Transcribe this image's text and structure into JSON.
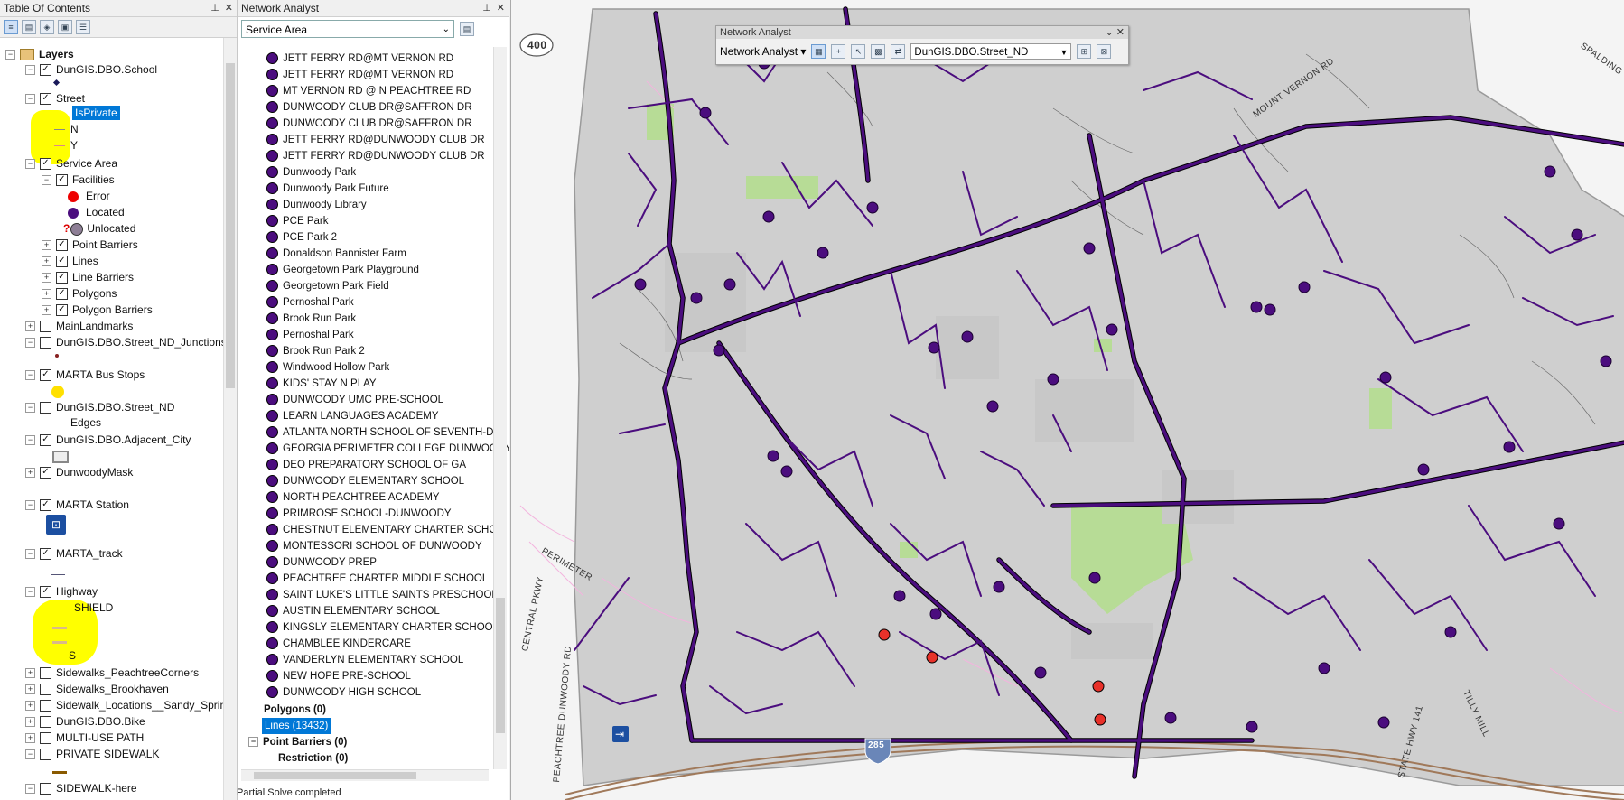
{
  "toc": {
    "title": "Table Of Contents",
    "layers_root": "Layers",
    "items": [
      {
        "label": "DunGIS.DBO.School",
        "checked": true
      },
      {
        "label": "Street",
        "checked": true
      },
      {
        "label": "IsPrivate"
      },
      {
        "label": "N"
      },
      {
        "label": "Y"
      },
      {
        "label": "Service Area",
        "checked": true
      },
      {
        "label": "Facilities",
        "checked": true
      },
      {
        "label": "Error"
      },
      {
        "label": "Located"
      },
      {
        "label": "Unlocated"
      },
      {
        "label": "Point Barriers",
        "checked": true
      },
      {
        "label": "Lines",
        "checked": true
      },
      {
        "label": "Line Barriers",
        "checked": true
      },
      {
        "label": "Polygons",
        "checked": true
      },
      {
        "label": "Polygon Barriers",
        "checked": true
      },
      {
        "label": "MainLandmarks",
        "checked": false
      },
      {
        "label": "DunGIS.DBO.Street_ND_Junctions",
        "checked": false
      },
      {
        "label": "MARTA Bus Stops",
        "checked": true
      },
      {
        "label": "DunGIS.DBO.Street_ND",
        "checked": false
      },
      {
        "label": "Edges"
      },
      {
        "label": "DunGIS.DBO.Adjacent_City",
        "checked": true
      },
      {
        "label": "DunwoodyMask",
        "checked": true
      },
      {
        "label": "MARTA Station",
        "checked": true
      },
      {
        "label": "MARTA_track",
        "checked": true
      },
      {
        "label": "Highway",
        "checked": true
      },
      {
        "label": "SHIELD"
      },
      {
        "label": "S"
      },
      {
        "label": "Sidewalks_PeachtreeCorners",
        "checked": false
      },
      {
        "label": "Sidewalks_Brookhaven",
        "checked": false
      },
      {
        "label": "Sidewalk_Locations__Sandy_Sprin",
        "checked": false
      },
      {
        "label": "DunGIS.DBO.Bike",
        "checked": false
      },
      {
        "label": "MULTI-USE  PATH",
        "checked": false
      },
      {
        "label": "PRIVATE SIDEWALK",
        "checked": false
      },
      {
        "label": "SIDEWALK-here",
        "checked": false
      }
    ]
  },
  "network_analyst_window": {
    "title": "Network Analyst",
    "analysis_select": "Service Area",
    "facilities": [
      "JETT FERRY RD@MT VERNON RD",
      "JETT FERRY RD@MT VERNON RD",
      "MT VERNON RD @ N  PEACHTREE RD",
      "DUNWOODY CLUB DR@SAFFRON DR",
      "DUNWOODY CLUB DR@SAFFRON DR",
      "JETT FERRY RD@DUNWOODY CLUB DR",
      "JETT FERRY RD@DUNWOODY CLUB DR",
      "Dunwoody Park",
      "Dunwoody Park Future",
      "Dunwoody Library",
      "PCE Park",
      "PCE Park 2",
      "Donaldson Bannister Farm",
      "Georgetown Park Playground",
      "Georgetown Park Field",
      "Pernoshal Park",
      "Brook Run Park",
      "Pernoshal Park",
      "Brook Run Park 2",
      "Windwood Hollow Park",
      "KIDS' STAY N PLAY",
      "DUNWOODY UMC PRE-SCHOOL",
      "LEARN LANGUAGES ACADEMY",
      "ATLANTA NORTH SCHOOL OF SEVENTH-DA",
      "GEORGIA PERIMETER COLLEGE DUNWOODY",
      "DEO PREPARATORY SCHOOL OF GA",
      "DUNWOODY ELEMENTARY SCHOOL",
      "NORTH PEACHTREE ACADEMY",
      "PRIMROSE SCHOOL-DUNWOODY",
      "CHESTNUT ELEMENTARY CHARTER SCHOO",
      "MONTESSORI SCHOOL OF DUNWOODY",
      "DUNWOODY PREP",
      "PEACHTREE CHARTER MIDDLE SCHOOL",
      "SAINT LUKE'S LITTLE SAINTS PRESCHOOL",
      "AUSTIN ELEMENTARY SCHOOL",
      "KINGSLY ELEMENTARY CHARTER SCHOOL",
      "CHAMBLEE KINDERCARE",
      "VANDERLYN ELEMENTARY SCHOOL",
      "NEW HOPE PRE-SCHOOL",
      "DUNWOODY HIGH SCHOOL"
    ],
    "polygons_label": "Polygons (0)",
    "lines_label": "Lines (13432)",
    "point_barriers_label": "Point Barriers (0)",
    "restriction_label": "Restriction (0)"
  },
  "status_bar": {
    "text": "Partial Solve completed"
  },
  "na_toolbar": {
    "title": "Network Analyst",
    "menu_label": "Network Analyst",
    "dataset": "DunGIS.DBO.Street_ND"
  },
  "map_labels": {
    "shield_400": "400",
    "mount_vernon": "MOUNT VERNON RD",
    "spalding": "SPALDING",
    "perimeter": "PERIMETER",
    "central_pkwy": "CENTRAL PKWY",
    "peachtree_dunwoody": "PEACHTREE DUNWOODY RD",
    "shield_285": "285",
    "state_hwy": "STATE HWY 141",
    "tilly_mill": "TILLY MILL"
  },
  "colors": {
    "network": "#4b0d7e",
    "highlight": "#ffff00",
    "selection": "#0078d7"
  }
}
